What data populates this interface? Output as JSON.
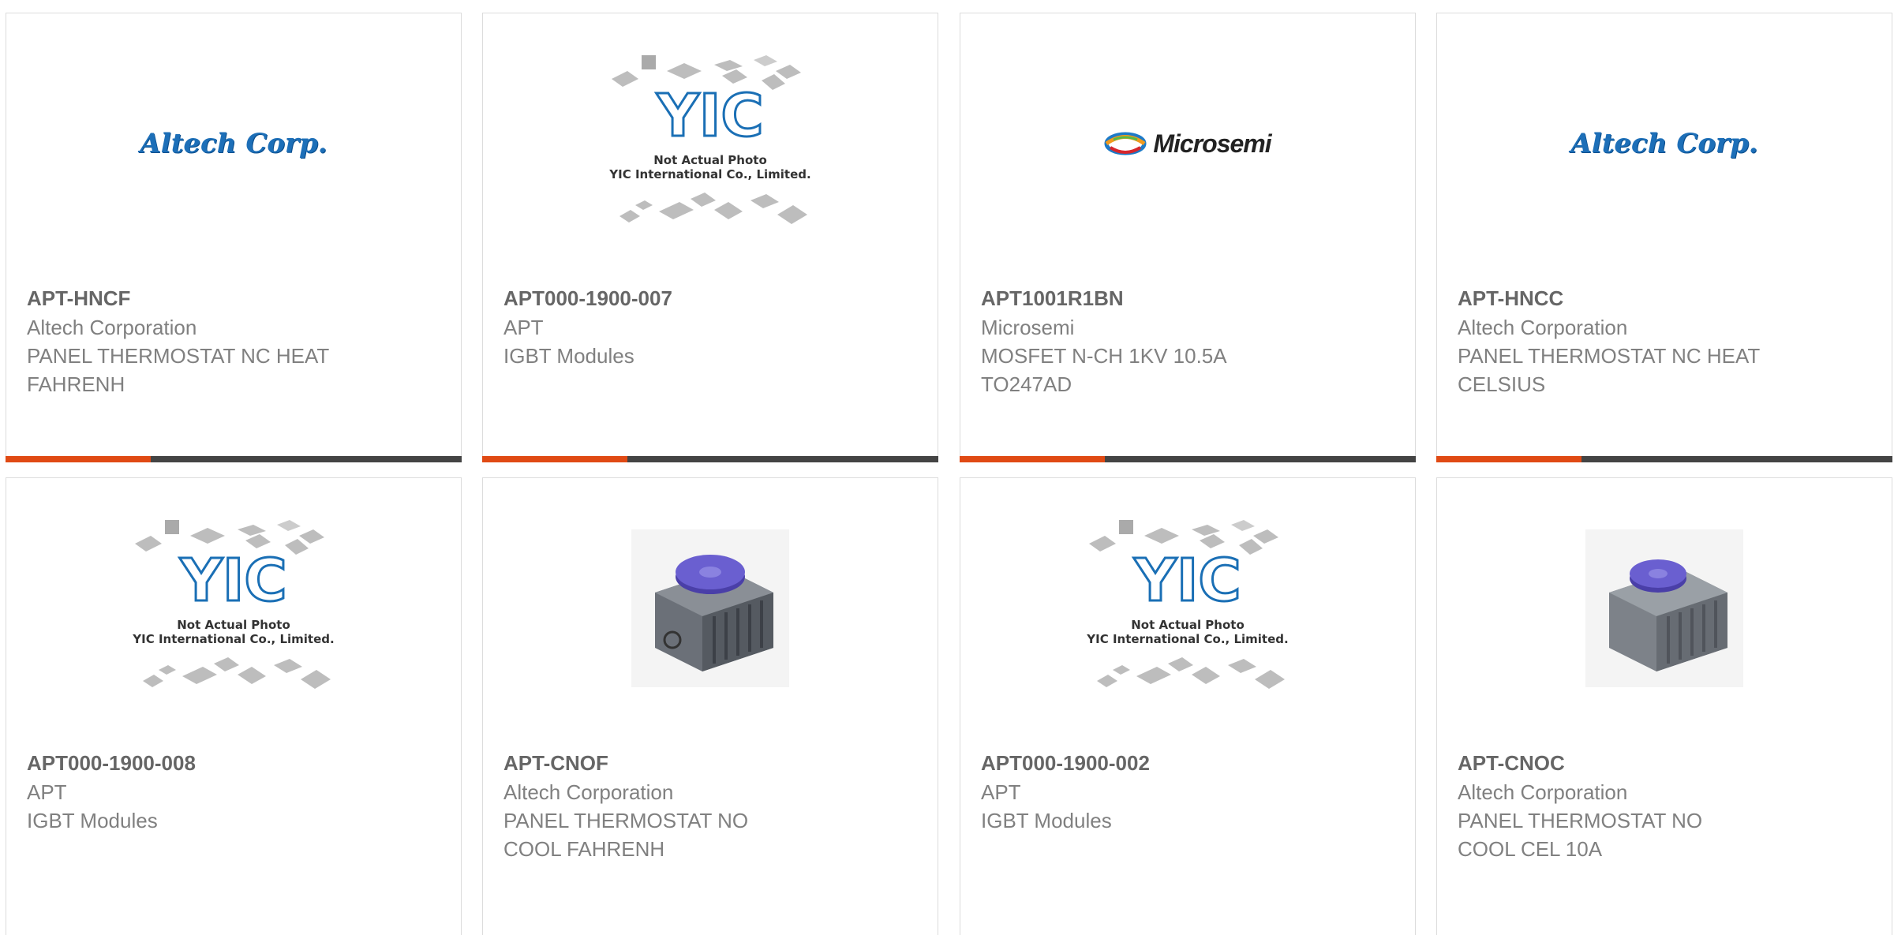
{
  "products": [
    {
      "part": "APT-HNCF",
      "manufacturer": "Altech Corporation",
      "desc1": "PANEL THERMOSTAT NC HEAT",
      "desc2": "FAHRENH",
      "image": "altech-logo"
    },
    {
      "part": "APT000-1900-007",
      "manufacturer": "APT",
      "desc1": "IGBT Modules",
      "desc2": "",
      "image": "yic-placeholder"
    },
    {
      "part": "APT1001R1BN",
      "manufacturer": "Microsemi",
      "desc1": "MOSFET N-CH 1KV 10.5A",
      "desc2": "TO247AD",
      "image": "microsemi-logo"
    },
    {
      "part": "APT-HNCC",
      "manufacturer": "Altech Corporation",
      "desc1": "PANEL THERMOSTAT NC HEAT",
      "desc2": "CELSIUS",
      "image": "altech-logo"
    },
    {
      "part": "APT000-1900-008",
      "manufacturer": "APT",
      "desc1": "IGBT Modules",
      "desc2": "",
      "image": "yic-placeholder"
    },
    {
      "part": "APT-CNOF",
      "manufacturer": "Altech Corporation",
      "desc1": "PANEL THERMOSTAT NO",
      "desc2": "COOL FAHRENH",
      "image": "thermostat-photo"
    },
    {
      "part": "APT000-1900-002",
      "manufacturer": "APT",
      "desc1": "IGBT Modules",
      "desc2": "",
      "image": "yic-placeholder"
    },
    {
      "part": "APT-CNOC",
      "manufacturer": "Altech Corporation",
      "desc1": "PANEL THERMOSTAT NO",
      "desc2": "COOL CEL 10A",
      "image": "thermostat-photo"
    }
  ],
  "logos": {
    "altech": "Altech Corp.",
    "microsemi": "Microsemi",
    "yic_line1": "Not Actual Photo",
    "yic_line2": "YIC International Co., Limited."
  },
  "colors": {
    "accent": "#e04a14",
    "bar": "#444444",
    "altech_blue": "#1d6fb8"
  }
}
